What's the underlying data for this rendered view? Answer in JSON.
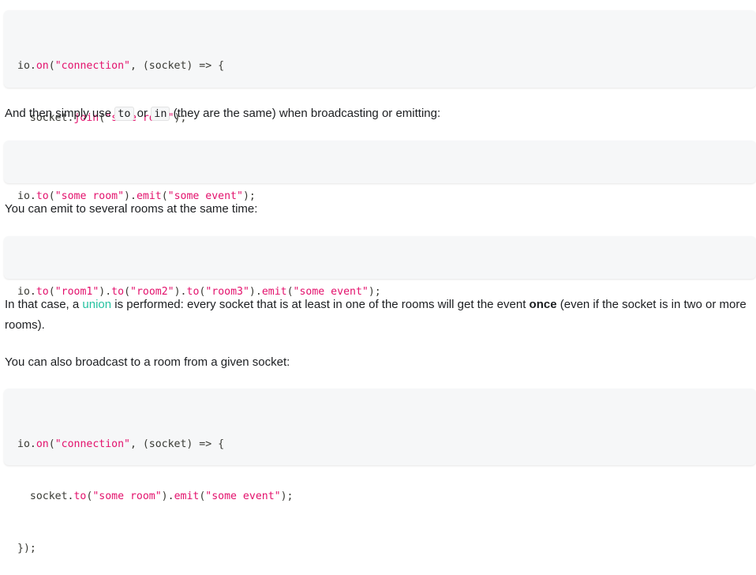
{
  "blocks": {
    "code1": {
      "l1": [
        "io",
        ".",
        "on",
        "(",
        "\"connection\"",
        ", (socket) => {"
      ],
      "l2": [
        "  socket",
        ".",
        "join",
        "(",
        "\"some room\"",
        ");"
      ],
      "l3": "});"
    },
    "para1": {
      "pre": "And then simply use ",
      "code_a": "to",
      "mid": " or ",
      "code_b": "in",
      "post": " (they are the same) when broadcasting or emitting:"
    },
    "code2": {
      "l1": [
        "io",
        ".",
        "to",
        "(",
        "\"some room\"",
        ")",
        ".",
        "emit",
        "(",
        "\"some event\"",
        ");"
      ]
    },
    "para2": {
      "text": "You can emit to several rooms at the same time:"
    },
    "code3": {
      "l1": [
        "io",
        ".",
        "to",
        "(",
        "\"room1\"",
        ")",
        ".",
        "to",
        "(",
        "\"room2\"",
        ")",
        ".",
        "to",
        "(",
        "\"room3\"",
        ")",
        ".",
        "emit",
        "(",
        "\"some event\"",
        ");"
      ]
    },
    "para3": {
      "pre": "In that case, a ",
      "link": "union",
      "mid": " is performed: every socket that is at least in one of the rooms will get the event ",
      "bold": "once",
      "post": " (even if the socket is in two or more rooms)."
    },
    "para4": {
      "text": "You can also broadcast to a room from a given socket:"
    },
    "code4": {
      "l1": [
        "io",
        ".",
        "on",
        "(",
        "\"connection\"",
        ", (socket) => {"
      ],
      "l2": [
        "  socket",
        ".",
        "to",
        "(",
        "\"some room\"",
        ")",
        ".",
        "emit",
        "(",
        "\"some event\"",
        ");"
      ],
      "l3": "});"
    }
  },
  "colors": {
    "function": "#36acaa",
    "string": "#e3116c",
    "link": "#25c2a0",
    "code_bg": "#f6f7f8"
  }
}
